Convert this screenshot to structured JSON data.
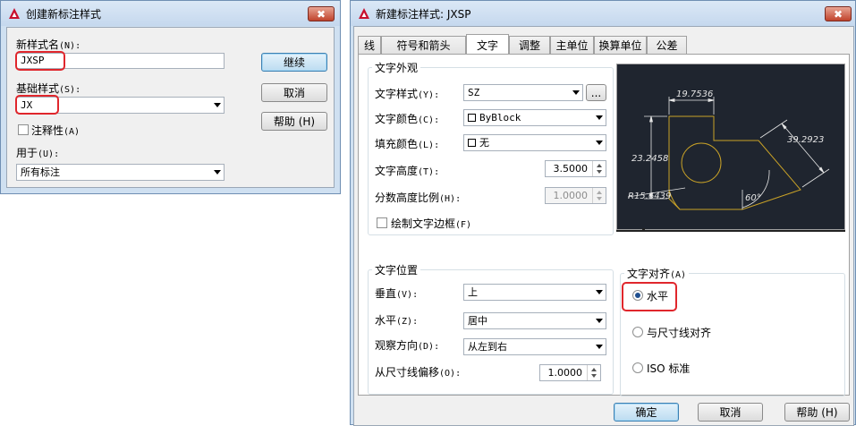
{
  "create_dialog": {
    "title": "创建新标注样式",
    "close_glyph": "✖",
    "new_style_label": "新样式名",
    "new_style_hotkey": "(N):",
    "new_style_value": "JXSP",
    "base_style_label": "基础样式",
    "base_style_hotkey": "(S):",
    "base_style_value": "JX",
    "annotative_label": "注释性",
    "annotative_hotkey": "(A)",
    "use_for_label": "用于",
    "use_for_hotkey": "(U):",
    "use_for_value": "所有标注",
    "continue_button": "继续",
    "cancel_button": "取消",
    "help_button": "帮助 (H)"
  },
  "modify_dialog": {
    "title": "新建标注样式: JXSP",
    "close_glyph": "✖",
    "tabs": [
      "线",
      "符号和箭头",
      "文字",
      "调整",
      "主单位",
      "换算单位",
      "公差"
    ],
    "active_tab": 2,
    "appearance_group": "文字外观",
    "text_style_label": "文字样式",
    "text_style_hotkey": "(Y):",
    "text_style_value": "SZ",
    "text_style_browse": "...",
    "text_color_label": "文字颜色",
    "text_color_hotkey": "(C):",
    "text_color_value": "ByBlock",
    "fill_color_label": "填充颜色",
    "fill_color_hotkey": "(L):",
    "fill_color_value": "无",
    "text_height_label": "文字高度",
    "text_height_hotkey": "(T):",
    "text_height_value": "3.5000",
    "fraction_scale_label": "分数高度比例",
    "fraction_scale_hotkey": "(H):",
    "fraction_scale_value": "1.0000",
    "draw_frame_label": "绘制文字边框",
    "draw_frame_hotkey": "(F)",
    "placement_group": "文字位置",
    "vertical_label": "垂直",
    "vertical_hotkey": "(V):",
    "vertical_value": "上",
    "horizontal_label": "水平",
    "horizontal_hotkey": "(Z):",
    "horizontal_value": "居中",
    "view_dir_label": "观察方向",
    "view_dir_hotkey": "(D):",
    "view_dir_value": "从左到右",
    "offset_label": "从尺寸线偏移",
    "offset_hotkey": "(O):",
    "offset_value": "1.0000",
    "alignment_group": "文字对齐",
    "alignment_hotkey": "(A)",
    "align_horizontal": "水平",
    "align_dimline": "与尺寸线对齐",
    "align_iso": "ISO 标准",
    "ok_button": "确定",
    "cancel_button": "取消",
    "help_button": "帮助 (H)",
    "preview": {
      "dim_top": "19.7536",
      "dim_left": "23.2458",
      "dim_diag": "39.2923",
      "angle": "60°",
      "radius": "R15.6439"
    }
  },
  "colors": {
    "highlight_box": "#e0262c",
    "preview_bg": "#1f252f",
    "preview_geometry": "#c9a227",
    "preview_dims": "#e6e6e6",
    "app_icon": "#c8102e"
  },
  "icons": [
    "autocad-logo-icon",
    "close-icon",
    "chevron-down-icon",
    "spin-up-icon",
    "spin-down-icon"
  ]
}
